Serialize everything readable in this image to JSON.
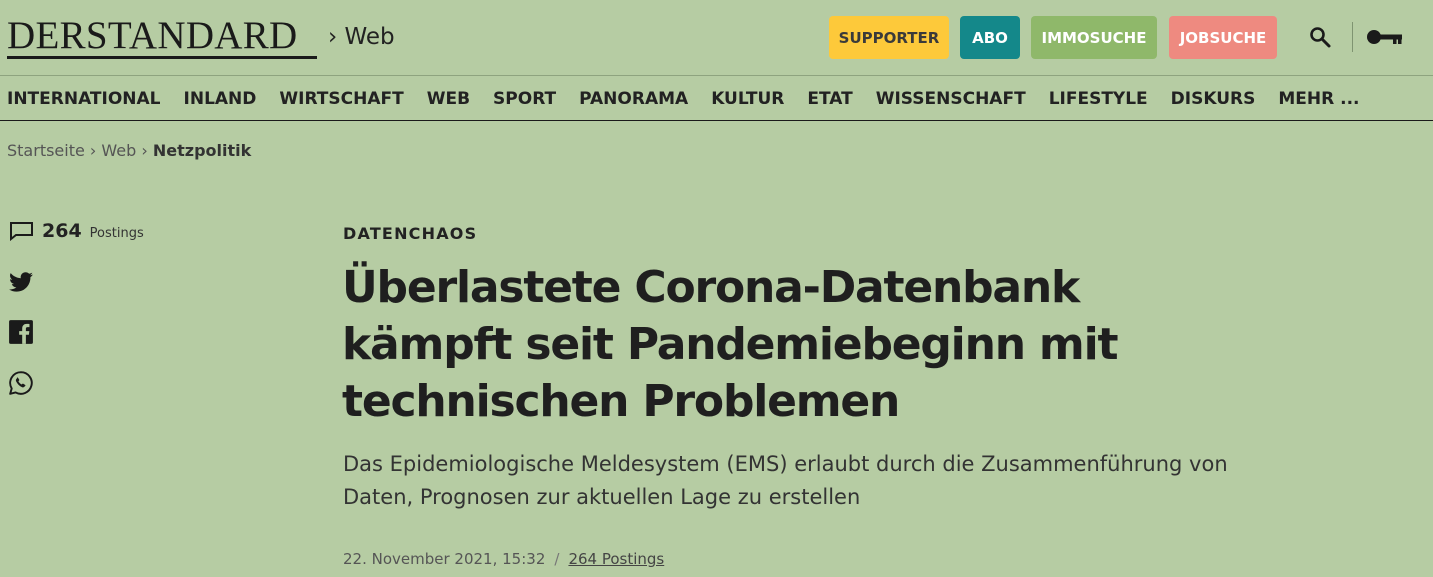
{
  "header": {
    "logo": "DERSTANDARD",
    "section": "› Web",
    "buttons": {
      "supporter": "SUPPORTER",
      "abo": "ABO",
      "immosuche": "IMMOSUCHE",
      "jobsuche": "JOBSUCHE"
    },
    "icons": [
      "search-icon",
      "key-icon"
    ],
    "colors": {
      "background": "#b6cca3",
      "supporter": "#fdc93a",
      "abo": "#14888a",
      "immosuche": "#8fb86a",
      "jobsuche": "#ee8a80"
    }
  },
  "nav": {
    "items": [
      "INTERNATIONAL",
      "INLAND",
      "WIRTSCHAFT",
      "WEB",
      "SPORT",
      "PANORAMA",
      "KULTUR",
      "ETAT",
      "WISSENSCHAFT",
      "LIFESTYLE",
      "DISKURS",
      "MEHR ..."
    ]
  },
  "breadcrumb": {
    "items": [
      "Startseite",
      "Web",
      "Netzpolitik"
    ]
  },
  "sidebar": {
    "postings_count": "264",
    "postings_label": "Postings",
    "share_icons": [
      "twitter-icon",
      "facebook-icon",
      "whatsapp-icon"
    ]
  },
  "article": {
    "kicker": "DATENCHAOS",
    "headline": "Überlastete Corona-Datenbank kämpft seit Pandemiebeginn mit technischen Problemen",
    "lead": "Das Epidemiologische Meldesystem (EMS) erlaubt durch die Zusammenführung von Daten, Prognosen zur aktuellen Lage zu erstellen",
    "date": "22. November 2021, 15:32",
    "separator": "/",
    "postings_link": "264 Postings"
  }
}
